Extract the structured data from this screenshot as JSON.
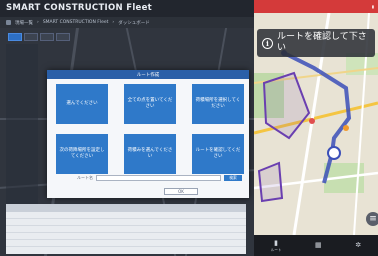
{
  "desktop": {
    "app_title": "SMART CONSTRUCTION Fleet",
    "breadcrumb": [
      "現場一覧",
      "SMART CONSTRUCTION Fleet",
      "ダッシュボード"
    ],
    "toolbar": [
      "",
      "",
      "",
      ""
    ],
    "table": {
      "headers": [
        "",
        "",
        "",
        "",
        ""
      ],
      "rows": [
        [
          "",
          "",
          "",
          "",
          ""
        ],
        [
          "",
          "",
          "",
          "",
          ""
        ],
        [
          "",
          "",
          "",
          "",
          ""
        ],
        [
          "",
          "",
          "",
          "",
          ""
        ],
        [
          "",
          "",
          "",
          "",
          ""
        ]
      ]
    }
  },
  "modal": {
    "title": "ルート作成",
    "tiles": [
      "選んでください",
      "全ての点を置いてください",
      "荷積場所を選択してください",
      "次の荷降場所を設定してください",
      "荷積みを選んでください",
      "ルートを確認してください"
    ],
    "search_label": "ルート名",
    "search_placeholder": "",
    "search_button": "検索",
    "ok_button": "OK"
  },
  "phone": {
    "status_time": "",
    "banner_text": "ルートを確認して下さい",
    "bottom_nav": [
      {
        "icon": "book-icon",
        "label": "ルート"
      },
      {
        "icon": "grid-icon",
        "label": ""
      },
      {
        "icon": "gear-icon",
        "label": ""
      }
    ]
  },
  "colors": {
    "tile_blue": "#2f79c9",
    "status_red": "#d43a3a",
    "route_blue": "#3b4fb8"
  }
}
